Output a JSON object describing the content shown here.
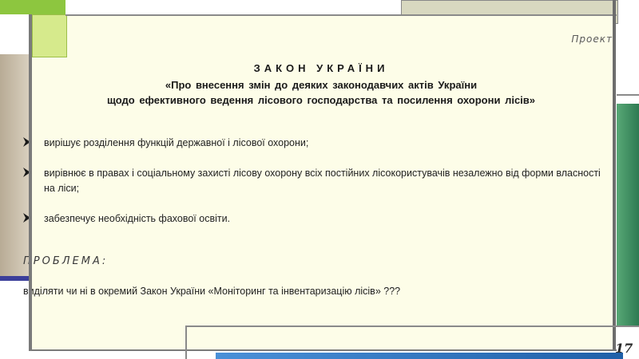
{
  "slide": {
    "project_label": "Проект",
    "law_title": "ЗАКОН УКРАЇНИ",
    "law_subtitle_1": "«Про внесення змін до деяких законодавчих актів України",
    "law_subtitle_2": "щодо ефективного ведення лісового господарства та посилення охорони лісів»",
    "bullets": [
      "вирішує розділення функцій державної і лісової охорони;",
      "вирівнює в правах і соціальному захисті лісову охорону всіх постійних лісокористувачів незалежно від форми власності на ліси;",
      "забезпечує необхідність фахової освіти."
    ],
    "problem_label": "ПРОБЛЕМА:",
    "problem_text": "виділяти чи ні в окремий Закон України «Моніторинг та інвентаризацію лісів» ???",
    "page_number": "17"
  },
  "icons": {
    "bullet": "arrow-bullet-icon"
  },
  "colors": {
    "slide_background": "#fdfde8",
    "accent_green": "#8dc63f",
    "accent_teal": "#2e7a52",
    "accent_blue": "#1f5fa8"
  }
}
